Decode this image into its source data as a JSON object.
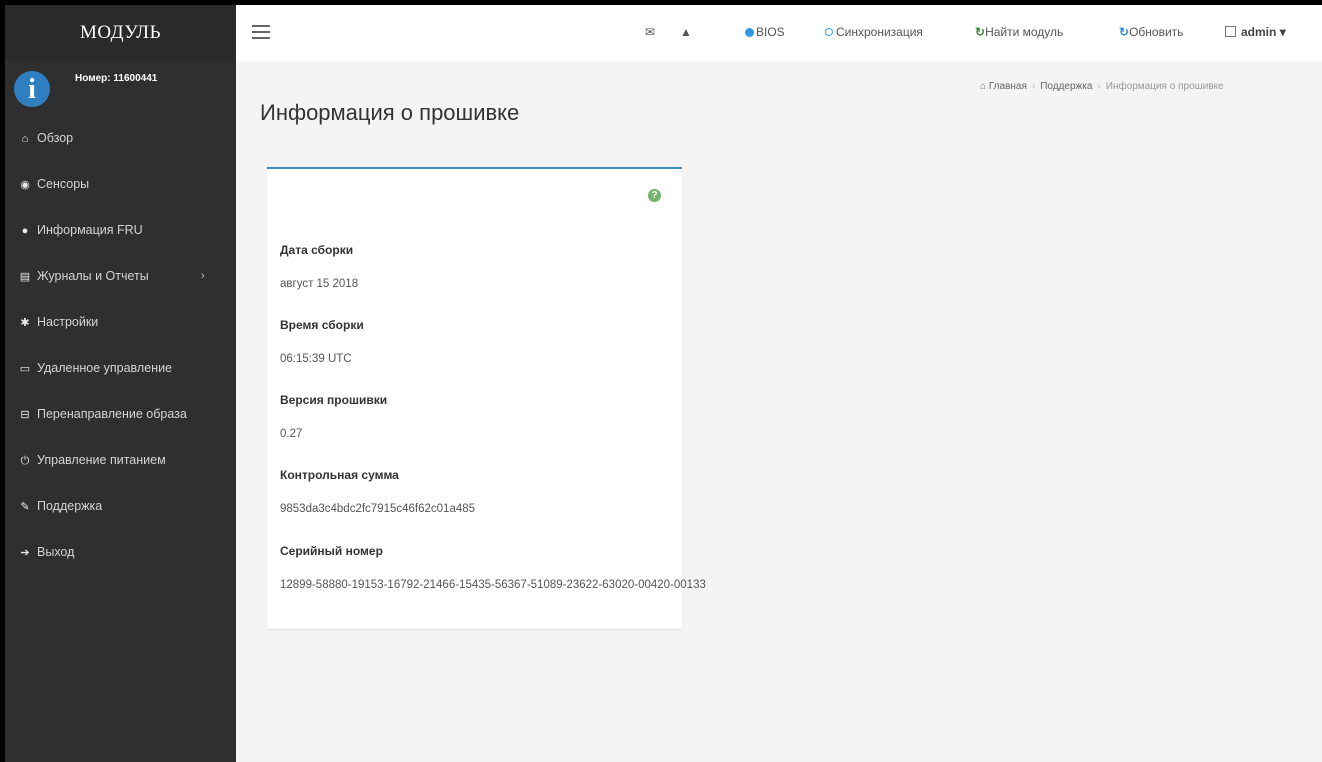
{
  "sidebar": {
    "brand": "МОДУЛЬ",
    "user_number": "Номер: 11600441",
    "items": [
      {
        "label": "Обзор",
        "icon": "home-icon"
      },
      {
        "label": "Сенсоры",
        "icon": "gauge-icon"
      },
      {
        "label": "Информация FRU",
        "icon": "info-icon"
      },
      {
        "label": "Журналы и Отчеты",
        "icon": "bar-chart-icon",
        "chevron": "›"
      },
      {
        "label": "Настройки",
        "icon": "gear-icon"
      },
      {
        "label": "Удаленное управление",
        "icon": "monitor-icon"
      },
      {
        "label": "Перенаправление образа",
        "icon": "disk-icon"
      },
      {
        "label": "Управление питанием",
        "icon": "power-icon"
      },
      {
        "label": "Поддержка",
        "icon": "wrench-icon"
      },
      {
        "label": "Выход",
        "icon": "sign-out-icon"
      }
    ]
  },
  "topbar": {
    "bios": "BIOS",
    "sync": "Синхронизация",
    "find_module": "Найти модуль",
    "refresh": "Обновить",
    "user": "admin"
  },
  "page": {
    "title": "Информация о прошивке",
    "breadcrumb": [
      "Главная",
      "Поддержка",
      "Информация о прошивке"
    ]
  },
  "firmware": {
    "fields": [
      {
        "label": "Дата сборки",
        "value": "август 15 2018"
      },
      {
        "label": "Время сборки",
        "value": "06:15:39 UTC"
      },
      {
        "label": "Версия прошивки",
        "value": "0.27"
      },
      {
        "label": "Контрольная сумма",
        "value": "9853da3c4bdc2fc7915c46f62c01a485"
      },
      {
        "label": "Серийный номер",
        "value": "12899-58880-19153-16792-21466-15435-56367-51089-23622-63020-00420-00133"
      }
    ]
  },
  "colors": {
    "sidebar_bg": "#2f2f2f",
    "accent": "#3c8dbc",
    "info_icon": "#2f7fc1",
    "help_icon": "#72b36b"
  }
}
